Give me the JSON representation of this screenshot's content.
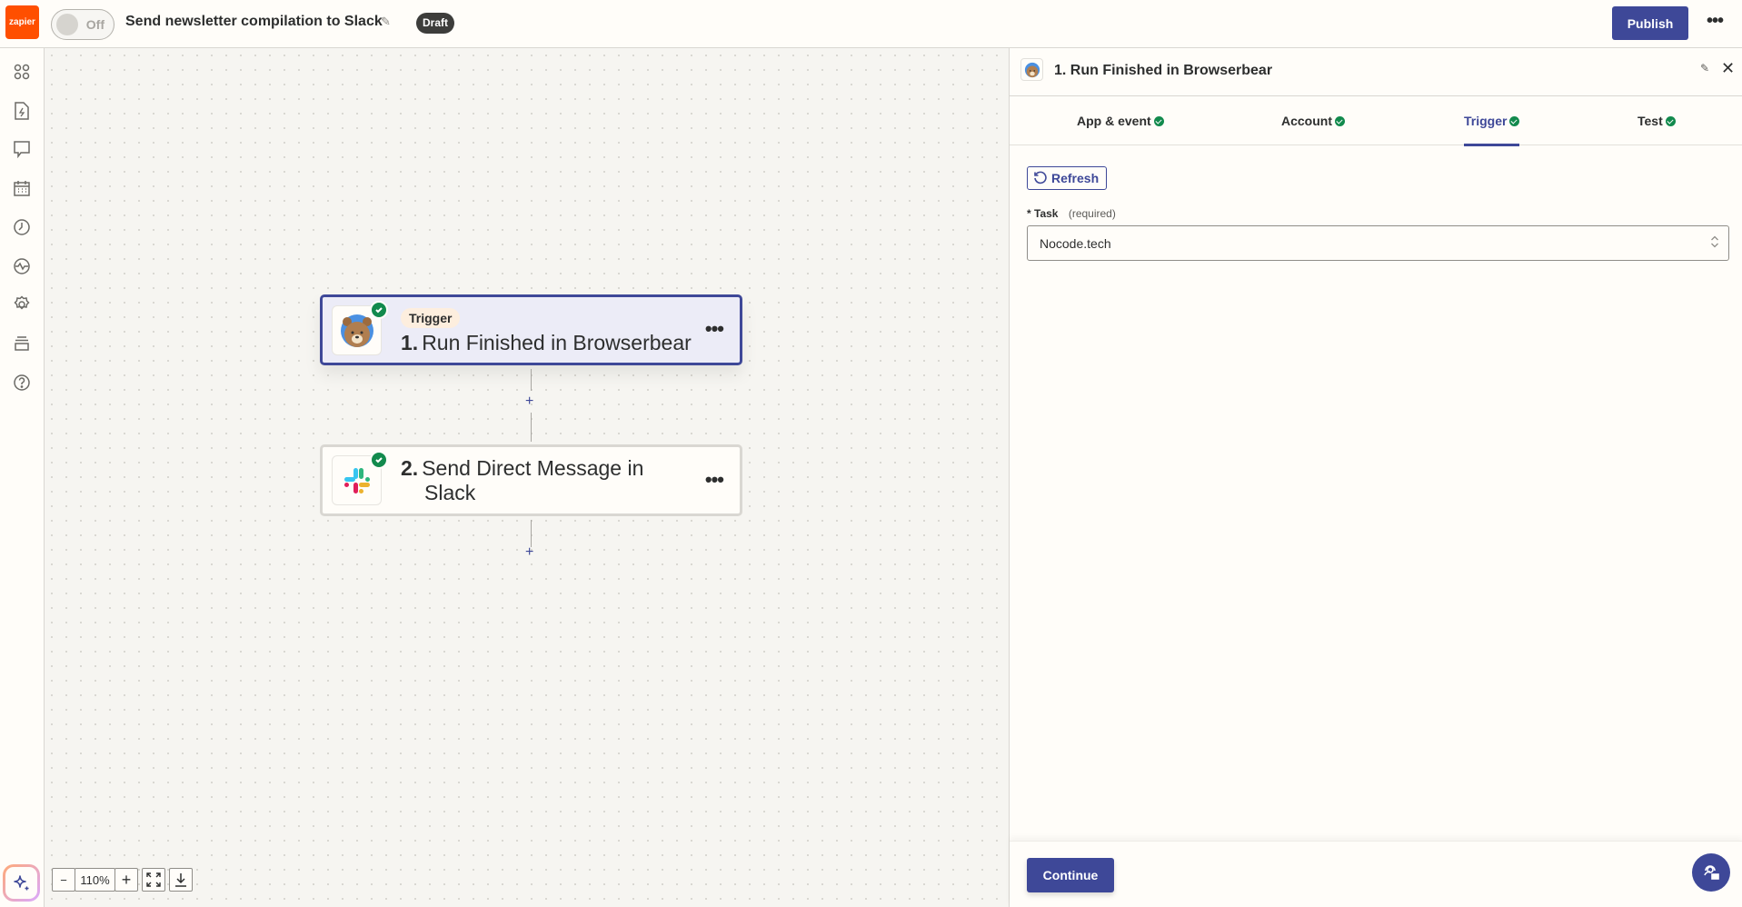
{
  "topbar": {
    "logo_text": "zapier",
    "toggle_label": "Off",
    "zap_title": "Send newsletter compilation to Slack",
    "status_badge": "Draft",
    "publish_label": "Publish",
    "more_label": "•••"
  },
  "sidebar": {
    "items": [
      {
        "icon": "apps-icon"
      },
      {
        "icon": "zap-file-icon"
      },
      {
        "icon": "chat-icon"
      },
      {
        "icon": "calendar-icon"
      },
      {
        "icon": "history-icon"
      },
      {
        "icon": "activity-icon"
      },
      {
        "icon": "settings-icon"
      },
      {
        "icon": "layers-icon"
      },
      {
        "icon": "help-icon"
      }
    ],
    "ai_button_icon": "sparkle-icon"
  },
  "canvas": {
    "steps": [
      {
        "badge": "Trigger",
        "number": "1.",
        "title": "Run Finished in Browserbear",
        "app": "Browserbear",
        "status": "complete",
        "selected": true
      },
      {
        "number": "2.",
        "title_line1": "Send Direct Message in",
        "title_line2": "Slack",
        "app": "Slack",
        "status": "complete",
        "selected": false
      }
    ],
    "add_step_label": "+",
    "zoom": {
      "minus": "−",
      "level": "110%",
      "plus": "+"
    }
  },
  "panel": {
    "title": "1. Run Finished in Browserbear",
    "tabs": [
      {
        "label": "App & event",
        "complete": true
      },
      {
        "label": "Account",
        "complete": true
      },
      {
        "label": "Trigger",
        "complete": true,
        "active": true
      },
      {
        "label": "Test",
        "complete": true
      }
    ],
    "refresh_label": "Refresh",
    "field": {
      "required_marker": "*",
      "label": "Task",
      "hint": "(required)",
      "value": "Nocode.tech"
    },
    "continue_label": "Continue"
  },
  "colors": {
    "brand": "#ff4f00",
    "primary": "#3e4898",
    "success": "#128a4d"
  }
}
